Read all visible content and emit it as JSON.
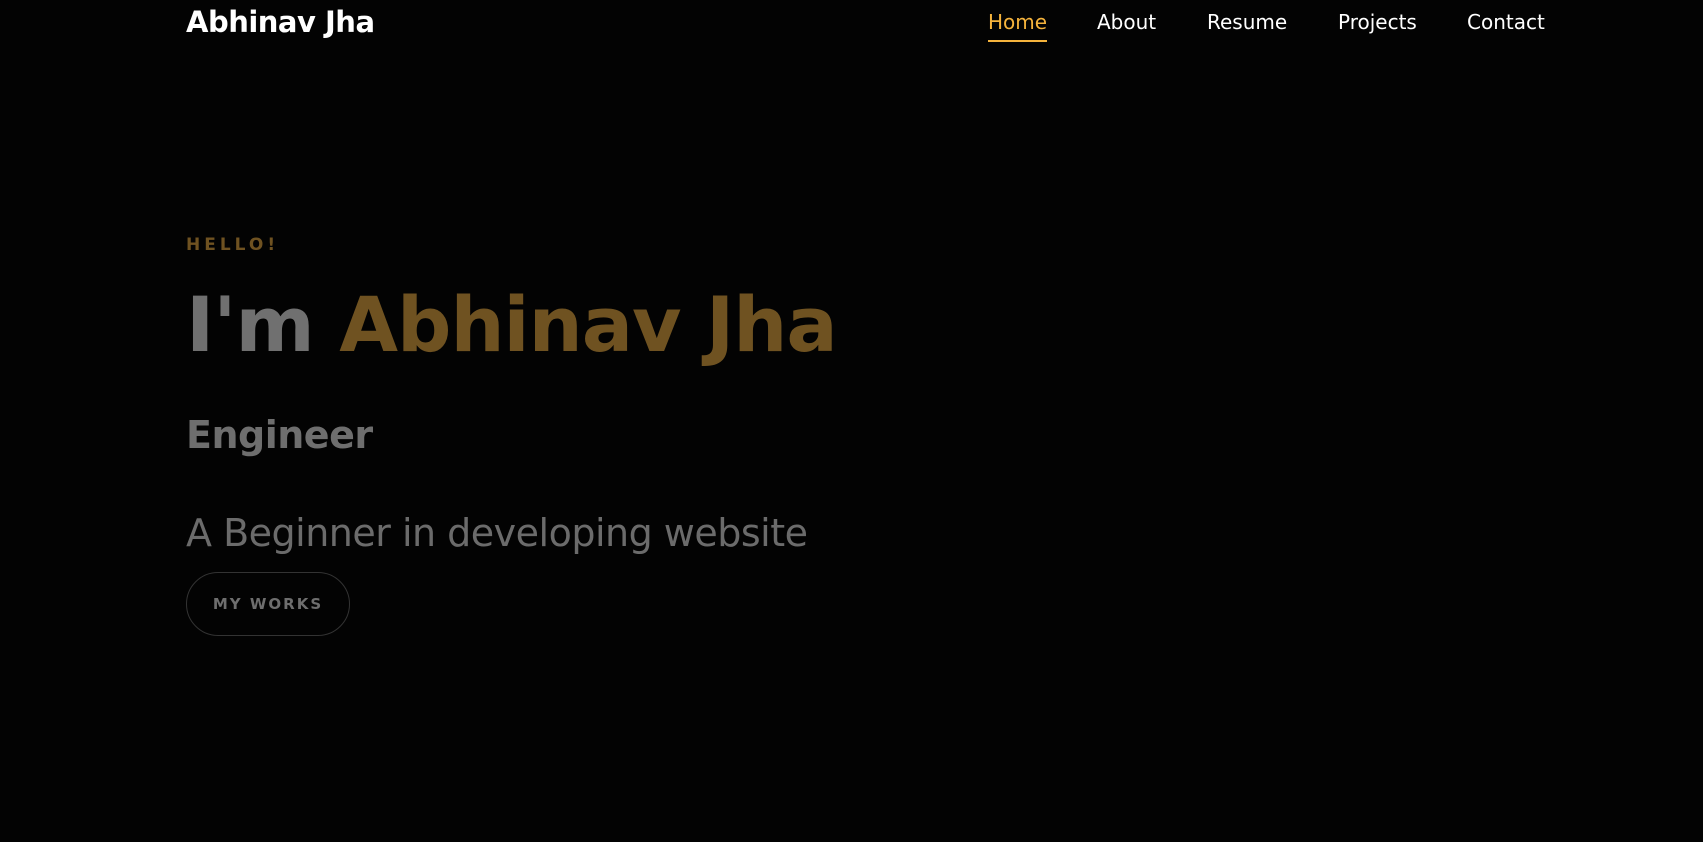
{
  "navbar": {
    "brand": "Abhinav Jha",
    "links": [
      {
        "label": "Home",
        "active": true
      },
      {
        "label": "About",
        "active": false
      },
      {
        "label": "Resume",
        "active": false
      },
      {
        "label": "Projects",
        "active": false
      },
      {
        "label": "Contact",
        "active": false
      }
    ]
  },
  "hero": {
    "greeting": "HELLO!",
    "title_prefix": "I'm",
    "title_name": "Abhinav Jha",
    "role": "Engineer",
    "tagline": "A Beginner in developing website",
    "button_label": "MY WORKS"
  },
  "colors": {
    "background": "#030303",
    "accent": "#f5b33c",
    "accent_dim": "#6f5221",
    "text_dim": "#6e6e6e",
    "nav_text": "#ffffff"
  }
}
